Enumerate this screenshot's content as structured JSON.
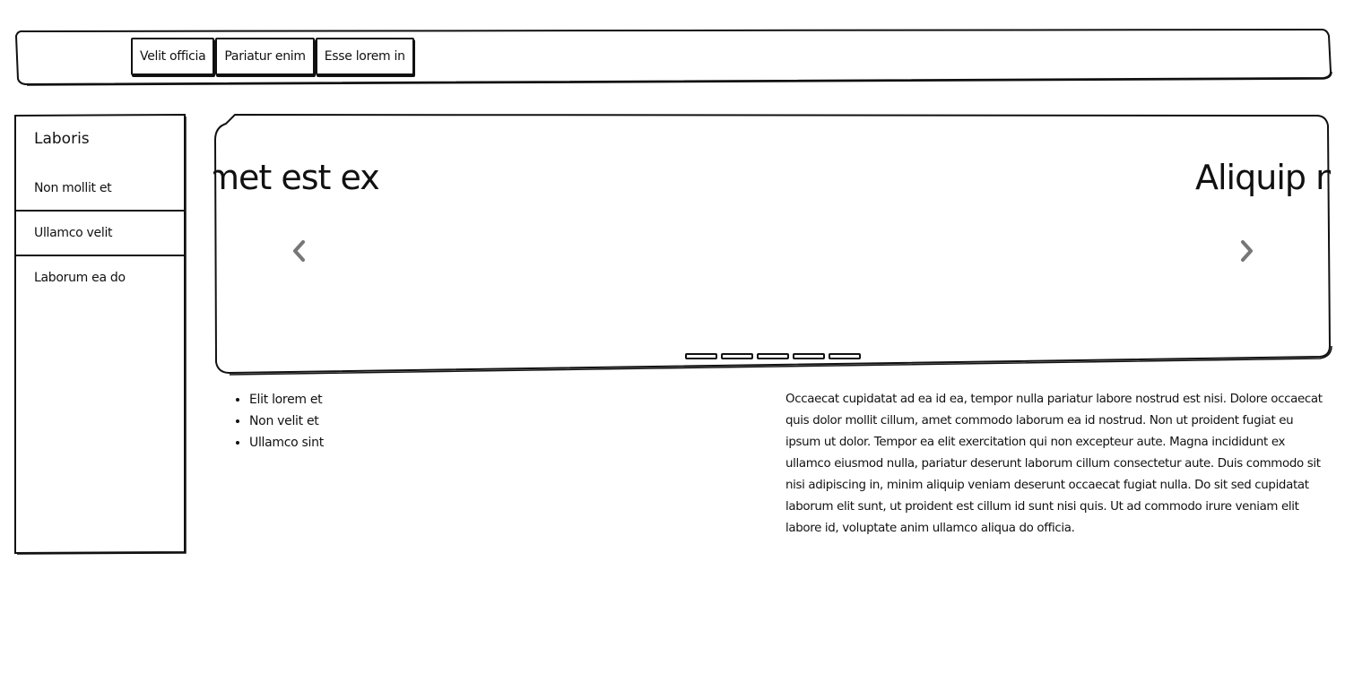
{
  "header": {
    "nav_buttons": [
      {
        "label": "Velit officia"
      },
      {
        "label": "Pariatur enim"
      },
      {
        "label": "Esse lorem in"
      }
    ]
  },
  "sidebar": {
    "title": "Laboris",
    "items": [
      {
        "label": "Non mollit et"
      },
      {
        "label": "Ullamco velit"
      },
      {
        "label": "Laborum ea do"
      }
    ]
  },
  "carousel": {
    "slide_left_text": "met est ex",
    "slide_right_text": "Aliquip no",
    "prev_icon": "chevron-left-icon",
    "next_icon": "chevron-right-icon",
    "indicator_count": 5,
    "arrow_color": "#777777"
  },
  "content": {
    "list_items": [
      "Elit lorem et",
      "Non velit et",
      "Ullamco sint"
    ],
    "paragraph": "Occaecat cupidatat ad ea id ea, tempor nulla pariatur labore nostrud est nisi. Dolore occaecat quis dolor mollit cillum, amet commodo laborum ea id nostrud. Non ut proident fugiat eu ipsum ut dolor. Tempor ea elit exercitation qui non excepteur aute. Magna incididunt ex ullamco eiusmod nulla, pariatur deserunt laborum cillum consectetur aute. Duis commodo sit nisi adipiscing in, minim aliquip veniam deserunt occaecat fugiat nulla. Do sit sed cupidatat laborum elit sunt, ut proident est cillum id sunt nisi quis. Ut ad commodo irure veniam elit labore id, voluptate anim ullamco aliqua do officia."
  }
}
